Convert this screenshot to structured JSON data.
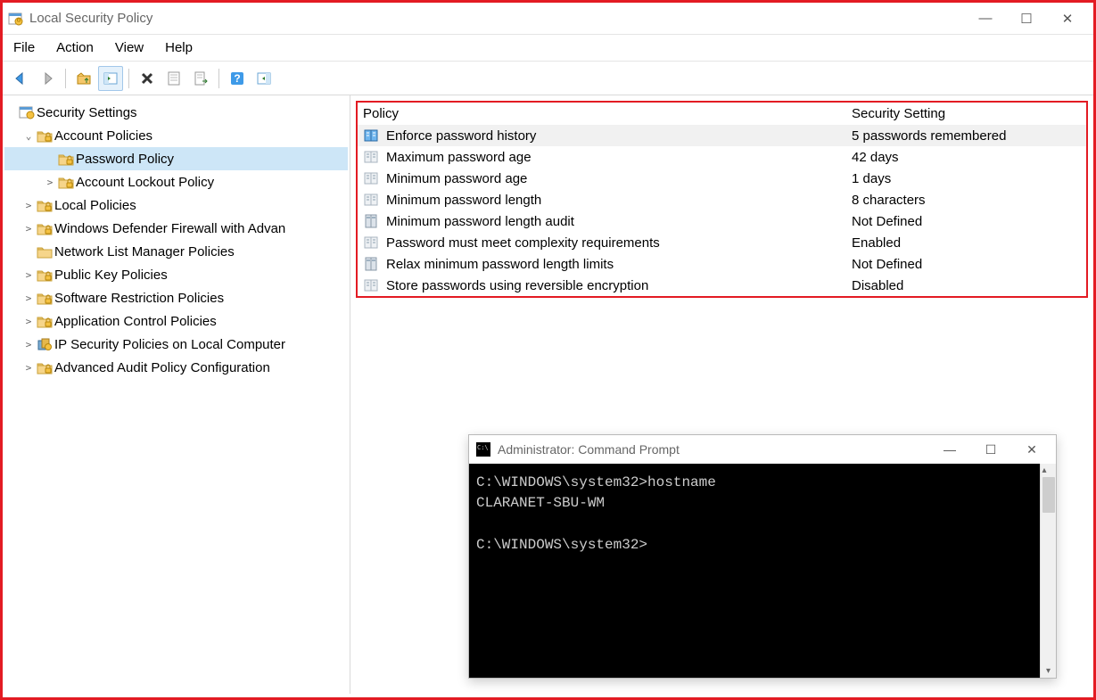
{
  "window": {
    "title": "Local Security Policy",
    "controls": {
      "min": "—",
      "max": "☐",
      "close": "✕"
    }
  },
  "menu": [
    "File",
    "Action",
    "View",
    "Help"
  ],
  "toolbar_names": [
    "back",
    "forward",
    "sep",
    "up",
    "show-hide-tree",
    "sep",
    "delete",
    "properties",
    "export-list",
    "sep",
    "help",
    "show-hide-action"
  ],
  "tree": {
    "root": "Security Settings",
    "items": [
      {
        "label": "Account Policies",
        "expander": "˅",
        "depth": 2,
        "children": [
          {
            "label": "Password Policy",
            "expander": "",
            "depth": 3,
            "selected": true
          },
          {
            "label": "Account Lockout Policy",
            "expander": "›",
            "depth": 3
          }
        ]
      },
      {
        "label": "Local Policies",
        "expander": "›",
        "depth": 2
      },
      {
        "label": "Windows Defender Firewall with Advan",
        "expander": "›",
        "depth": 2
      },
      {
        "label": "Network List Manager Policies",
        "expander": "",
        "depth": 2
      },
      {
        "label": "Public Key Policies",
        "expander": "›",
        "depth": 2
      },
      {
        "label": "Software Restriction Policies",
        "expander": "›",
        "depth": 2
      },
      {
        "label": "Application Control Policies",
        "expander": "›",
        "depth": 2
      },
      {
        "label": "IP Security Policies on Local Computer",
        "expander": "›",
        "depth": 2,
        "icon": "ipsec"
      },
      {
        "label": "Advanced Audit Policy Configuration",
        "expander": "›",
        "depth": 2
      }
    ]
  },
  "policy_table": {
    "headers": {
      "policy": "Policy",
      "setting": "Security Setting"
    },
    "rows": [
      {
        "name": "Enforce password history",
        "value": "5 passwords remembered",
        "selected": true,
        "ico": "blue"
      },
      {
        "name": "Maximum password age",
        "value": "42 days"
      },
      {
        "name": "Minimum password age",
        "value": "1 days"
      },
      {
        "name": "Minimum password length",
        "value": "8 characters"
      },
      {
        "name": "Minimum password length audit",
        "value": "Not Defined",
        "ico": "server"
      },
      {
        "name": "Password must meet complexity requirements",
        "value": "Enabled"
      },
      {
        "name": "Relax minimum password length limits",
        "value": "Not Defined",
        "ico": "server"
      },
      {
        "name": "Store passwords using reversible encryption",
        "value": "Disabled"
      }
    ]
  },
  "cmd": {
    "title": "Administrator: Command Prompt",
    "controls": {
      "min": "—",
      "max": "☐",
      "close": "✕"
    },
    "lines": "C:\\WINDOWS\\system32>hostname\nCLARANET-SBU-WM\n\nC:\\WINDOWS\\system32>"
  }
}
